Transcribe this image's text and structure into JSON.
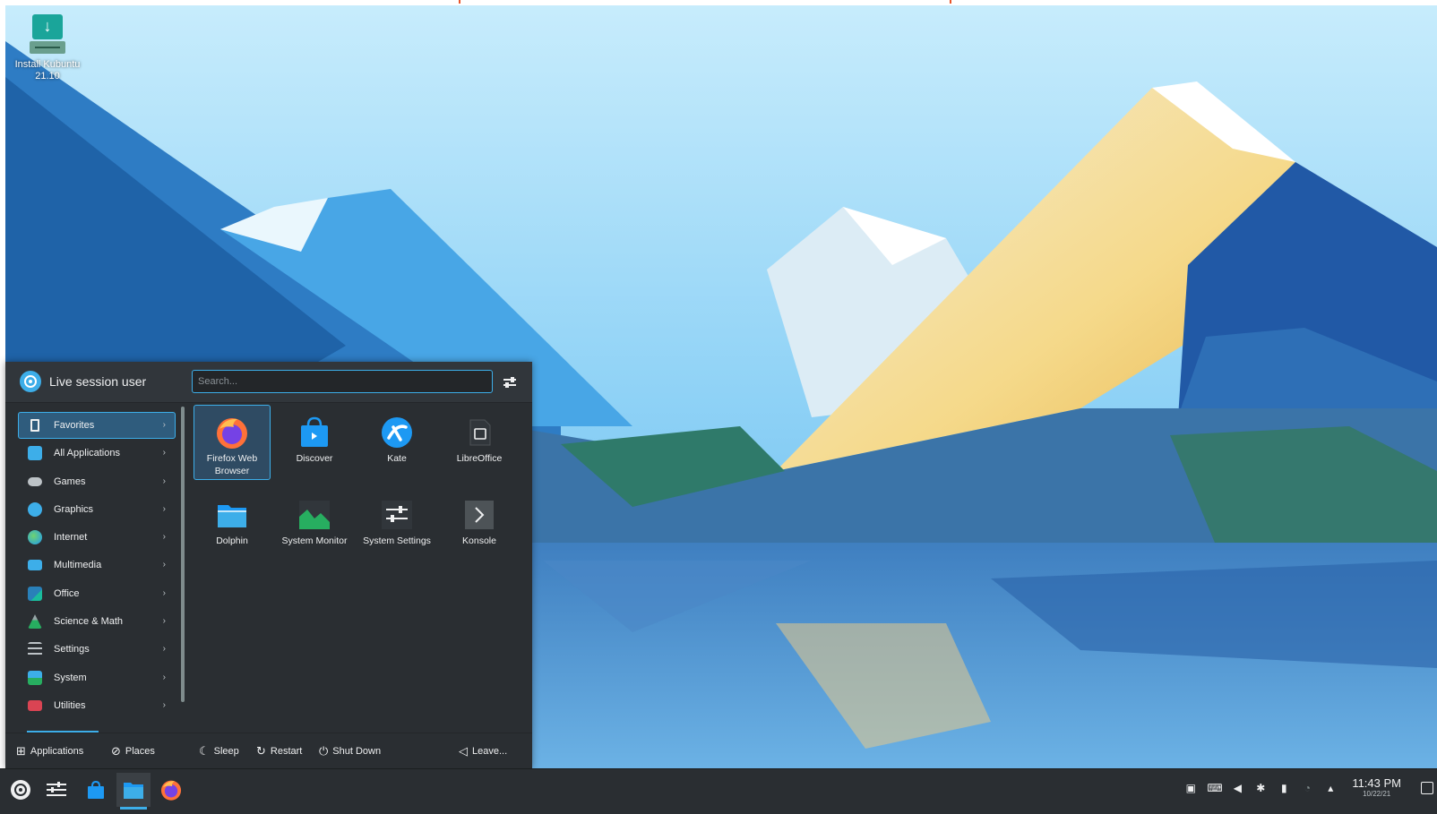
{
  "desktop": {
    "icon_label": "Install Kubuntu 21.10"
  },
  "launcher": {
    "user_name": "Live session user",
    "search": {
      "placeholder": "Search...",
      "value": ""
    },
    "categories": [
      {
        "label": "Favorites",
        "icon": "favorites-bookmark-icon",
        "color": "#eff0f1"
      },
      {
        "label": "All Applications",
        "icon": "all-applications-icon",
        "color": "#3daee9"
      },
      {
        "label": "Games",
        "icon": "games-icon",
        "color": "#bdc3c7"
      },
      {
        "label": "Graphics",
        "icon": "graphics-icon",
        "color": "#3daee9"
      },
      {
        "label": "Internet",
        "icon": "internet-globe-icon",
        "color": "#3daee9"
      },
      {
        "label": "Multimedia",
        "icon": "multimedia-icon",
        "color": "#3daee9"
      },
      {
        "label": "Office",
        "icon": "office-icon",
        "color": "#2980b9"
      },
      {
        "label": "Science & Math",
        "icon": "science-math-icon",
        "color": "#27ae60"
      },
      {
        "label": "Settings",
        "icon": "settings-icon",
        "color": "#bdc3c7"
      },
      {
        "label": "System",
        "icon": "system-icon",
        "color": "#3daee9"
      },
      {
        "label": "Utilities",
        "icon": "utilities-icon",
        "color": "#da4453"
      }
    ],
    "favorites": [
      {
        "label": "Firefox Web Browser",
        "icon": "firefox-icon"
      },
      {
        "label": "Discover",
        "icon": "discover-icon"
      },
      {
        "label": "Kate",
        "icon": "kate-icon"
      },
      {
        "label": "LibreOffice",
        "icon": "libreoffice-icon"
      },
      {
        "label": "Dolphin",
        "icon": "dolphin-folder-icon"
      },
      {
        "label": "System Monitor",
        "icon": "system-monitor-icon"
      },
      {
        "label": "System Settings",
        "icon": "system-settings-icon"
      },
      {
        "label": "Konsole",
        "icon": "konsole-terminal-icon"
      }
    ],
    "footer": {
      "applications": "Applications",
      "places": "Places",
      "sleep": "Sleep",
      "restart": "Restart",
      "shut_down": "Shut Down",
      "leave": "Leave..."
    }
  },
  "taskbar": {
    "clock_time": "11:43 PM",
    "clock_date": "10/22/21"
  },
  "colors": {
    "accent": "#3daee9",
    "panel": "#2a2e32",
    "text": "#eff0f1"
  }
}
